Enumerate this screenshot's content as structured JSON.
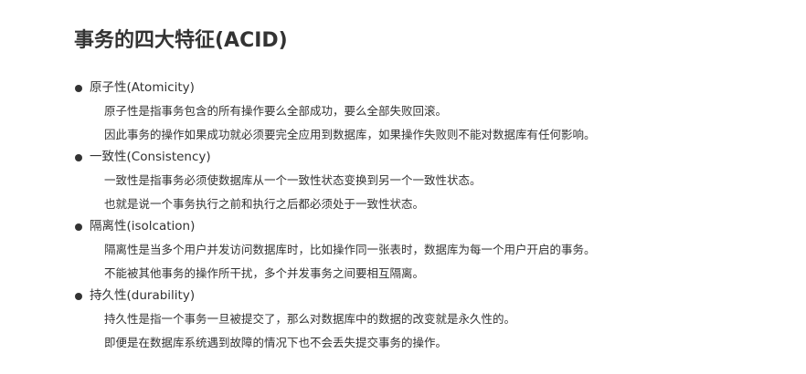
{
  "title": "事务的四大特征(ACID)",
  "properties": [
    {
      "heading": "原子性(Atomicity)",
      "lines": [
        "原子性是指事务包含的所有操作要么全部成功，要么全部失败回滚。",
        "因此事务的操作如果成功就必须要完全应用到数据库，如果操作失败则不能对数据库有任何影响。"
      ]
    },
    {
      "heading": "一致性(Consistency)",
      "lines": [
        "一致性是指事务必须使数据库从一个一致性状态变换到另一个一致性状态。",
        "也就是说一个事务执行之前和执行之后都必须处于一致性状态。"
      ]
    },
    {
      "heading": "隔离性(isolcation)",
      "lines": [
        "隔离性是当多个用户并发访问数据库时，比如操作同一张表时，数据库为每一个用户开启的事务。",
        "不能被其他事务的操作所干扰，多个并发事务之间要相互隔离。"
      ]
    },
    {
      "heading": "持久性(durability)",
      "lines": [
        "持久性是指一个事务一旦被提交了，那么对数据库中的数据的改变就是永久性的。",
        "即便是在数据库系统遇到故障的情况下也不会丢失提交事务的操作。"
      ]
    }
  ]
}
